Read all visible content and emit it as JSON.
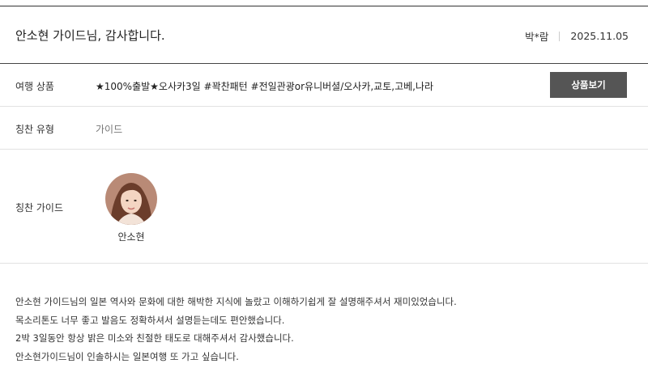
{
  "review": {
    "title": "안소현 가이드님, 감사합니다.",
    "author": "박*람",
    "date": "2025.11.05"
  },
  "product": {
    "label": "여행 상품",
    "value": "★100%출발★오사카3일 #꽉찬패턴 #전일관광or유니버셜/오사카,교토,고베,나라",
    "button_label": "상품보기"
  },
  "praise_type": {
    "label": "칭찬 유형",
    "value": "가이드"
  },
  "praise_guide": {
    "label": "칭찬 가이드",
    "guide_name": "안소현"
  },
  "content": {
    "lines": [
      "안소현 가이드님의 일본 역사와 문화에 대한 해박한 지식에 놀랐고 이해하기쉽게 잘 설명해주셔서 재미있었습니다.",
      "목소리톤도 너무 좋고 발음도 정확하셔서 설명듣는데도 편안했습니다.",
      "2박 3일동안 항상 밝은 미소와 친절한 태도로 대해주셔서 감사했습니다.",
      "안소현가이드님이 인솔하시는 일본여행 또 가고 싶습니다."
    ]
  },
  "colors": {
    "button_bg": "#555555",
    "divider": "#e2e2e2",
    "header_border": "#444444"
  },
  "icons": {
    "avatar": "guide-portrait-photo"
  }
}
